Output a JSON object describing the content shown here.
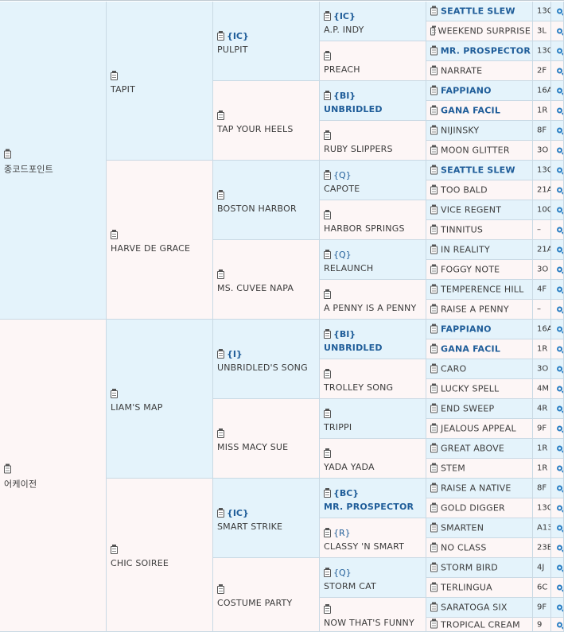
{
  "g1": [
    {
      "name": "종코드포인트"
    },
    {
      "name": "어케이전"
    }
  ],
  "g2": [
    {
      "name": "TAPIT"
    },
    {
      "name": "HARVE DE GRACE"
    },
    {
      "name": "LIAM'S MAP"
    },
    {
      "name": "CHIC SOIREE"
    }
  ],
  "g3": [
    {
      "tag": "{IC}",
      "name": "PULPIT"
    },
    {
      "tag": "",
      "name": "TAP YOUR HEELS"
    },
    {
      "tag": "",
      "name": "BOSTON HARBOR"
    },
    {
      "tag": "",
      "name": "MS. CUVEE NAPA"
    },
    {
      "tag": "{I}",
      "name": "UNBRIDLED'S SONG"
    },
    {
      "tag": "",
      "name": "MISS MACY SUE"
    },
    {
      "tag": "{IC}",
      "name": "SMART STRIKE"
    },
    {
      "tag": "",
      "name": "COSTUME PARTY"
    }
  ],
  "g4": [
    {
      "tag": "{IC}",
      "name": "A.P. INDY",
      "bold": false
    },
    {
      "tag": "",
      "name": "PREACH",
      "bold": false
    },
    {
      "tag": "{BI}",
      "name": "UNBRIDLED",
      "bold": true
    },
    {
      "tag": "",
      "name": "RUBY SLIPPERS",
      "bold": false
    },
    {
      "tag": "{Q}",
      "name": "CAPOTE",
      "bold": false
    },
    {
      "tag": "",
      "name": "HARBOR SPRINGS",
      "bold": false
    },
    {
      "tag": "{Q}",
      "name": "RELAUNCH",
      "bold": false
    },
    {
      "tag": "",
      "name": "A PENNY IS A PENNY",
      "bold": false
    },
    {
      "tag": "{BI}",
      "name": "UNBRIDLED",
      "bold": true
    },
    {
      "tag": "",
      "name": "TROLLEY SONG",
      "bold": false
    },
    {
      "tag": "",
      "name": "TRIPPI",
      "bold": false
    },
    {
      "tag": "",
      "name": "YADA YADA",
      "bold": false
    },
    {
      "tag": "{BC}",
      "name": "MR. PROSPECTOR",
      "bold": true
    },
    {
      "tag": "{R}",
      "name": "CLASSY 'N SMART",
      "bold": false
    },
    {
      "tag": "{Q}",
      "name": "STORM CAT",
      "bold": false
    },
    {
      "tag": "",
      "name": "NOW THAT'S FUNNY",
      "bold": false
    }
  ],
  "g5": [
    {
      "name": "SEATTLE SLEW",
      "bold": true,
      "code": "13C"
    },
    {
      "name": "WEEKEND SURPRISE",
      "bold": false,
      "code": "3L"
    },
    {
      "name": "MR. PROSPECTOR",
      "bold": true,
      "code": "13C"
    },
    {
      "name": "NARRATE",
      "bold": false,
      "code": "2F"
    },
    {
      "name": "FAPPIANO",
      "bold": true,
      "code": "16A"
    },
    {
      "name": "GANA FACIL",
      "bold": true,
      "code": "1R"
    },
    {
      "name": "NIJINSKY",
      "bold": false,
      "code": "8F"
    },
    {
      "name": "MOON GLITTER",
      "bold": false,
      "code": "3O"
    },
    {
      "name": "SEATTLE SLEW",
      "bold": true,
      "code": "13C"
    },
    {
      "name": "TOO BALD",
      "bold": false,
      "code": "21A"
    },
    {
      "name": "VICE REGENT",
      "bold": false,
      "code": "10C"
    },
    {
      "name": "TINNITUS",
      "bold": false,
      "code": "–"
    },
    {
      "name": "IN REALITY",
      "bold": false,
      "code": "21A"
    },
    {
      "name": "FOGGY NOTE",
      "bold": false,
      "code": "3O"
    },
    {
      "name": "TEMPERENCE HILL",
      "bold": false,
      "code": "4F"
    },
    {
      "name": "RAISE A PENNY",
      "bold": false,
      "code": "–"
    },
    {
      "name": "FAPPIANO",
      "bold": true,
      "code": "16A"
    },
    {
      "name": "GANA FACIL",
      "bold": true,
      "code": "1R"
    },
    {
      "name": "CARO",
      "bold": false,
      "code": "3O"
    },
    {
      "name": "LUCKY SPELL",
      "bold": false,
      "code": "4M"
    },
    {
      "name": "END SWEEP",
      "bold": false,
      "code": "4R"
    },
    {
      "name": "JEALOUS APPEAL",
      "bold": false,
      "code": "9F"
    },
    {
      "name": "GREAT ABOVE",
      "bold": false,
      "code": "1R"
    },
    {
      "name": "STEM",
      "bold": false,
      "code": "1R"
    },
    {
      "name": "RAISE A NATIVE",
      "bold": false,
      "code": "8F"
    },
    {
      "name": "GOLD DIGGER",
      "bold": false,
      "code": "13C"
    },
    {
      "name": "SMARTEN",
      "bold": false,
      "code": "A13"
    },
    {
      "name": "NO CLASS",
      "bold": false,
      "code": "23B"
    },
    {
      "name": "STORM BIRD",
      "bold": false,
      "code": "4J"
    },
    {
      "name": "TERLINGUA",
      "bold": false,
      "code": "6C"
    },
    {
      "name": "SARATOGA SIX",
      "bold": false,
      "code": "9F"
    },
    {
      "name": "TROPICAL CREAM",
      "bold": false,
      "code": "9"
    }
  ],
  "icons": {
    "info": "clipboard-icon",
    "search": "magnifier-icon"
  },
  "colors": {
    "blue": "#e4f3fb",
    "pink": "#fdf6f6",
    "link": "#1f5d99",
    "grid": "#c9d9e4"
  }
}
